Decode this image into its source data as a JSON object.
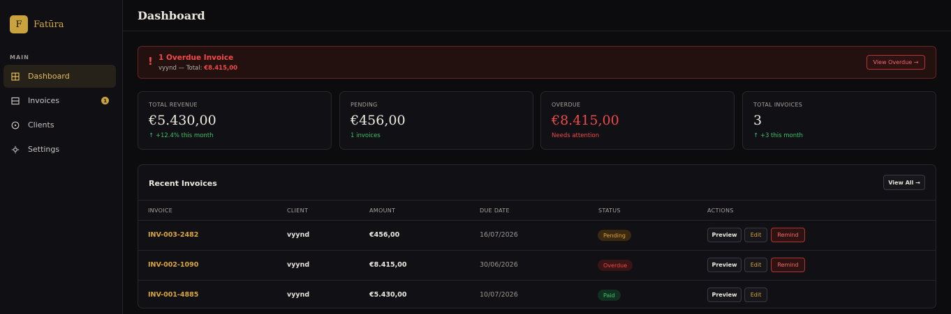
{
  "brand": {
    "logo_letter": "F",
    "name": "Fatūra"
  },
  "sidebar": {
    "section_label": "MAIN",
    "items": [
      {
        "label": "Dashboard",
        "icon": "grid-icon",
        "active": true
      },
      {
        "label": "Invoices",
        "icon": "invoice-icon",
        "badge": "1"
      },
      {
        "label": "Clients",
        "icon": "clients-icon"
      },
      {
        "label": "Settings",
        "icon": "gear-icon"
      }
    ]
  },
  "header": {
    "title": "Dashboard"
  },
  "alert": {
    "mark": "!",
    "title": "1 Overdue Invoice",
    "sub_prefix": "vyynd — Total:",
    "sub_amount": "€8.415,00",
    "button": "View Overdue →"
  },
  "stats": [
    {
      "label": "TOTAL REVENUE",
      "value": "€5.430,00",
      "sub": "↑ +12.4% this month"
    },
    {
      "label": "PENDING",
      "value": "€456,00",
      "sub": "1 invoices"
    },
    {
      "label": "OVERDUE",
      "value": "€8.415,00",
      "sub": "Needs attention"
    },
    {
      "label": "TOTAL INVOICES",
      "value": "3",
      "sub": "↑ +3 this month"
    }
  ],
  "recent": {
    "title": "Recent Invoices",
    "view_all": "View All →",
    "columns": [
      "INVOICE",
      "CLIENT",
      "AMOUNT",
      "DUE DATE",
      "STATUS",
      "ACTIONS"
    ],
    "rows": [
      {
        "invoice": "INV-003-2482",
        "client": "vyynd",
        "amount": "€456,00",
        "due": "16/07/2026",
        "status": "Pending",
        "preview": "Preview",
        "edit": "Edit",
        "remind": "Remind"
      },
      {
        "invoice": "INV-002-1090",
        "client": "vyynd",
        "amount": "€8.415,00",
        "due": "30/06/2026",
        "status": "Overdue",
        "preview": "Preview",
        "edit": "Edit",
        "remind": "Remind"
      },
      {
        "invoice": "INV-001-4885",
        "client": "vyynd",
        "amount": "€5.430,00",
        "due": "10/07/2026",
        "status": "Paid",
        "preview": "Preview",
        "edit": "Edit"
      }
    ]
  },
  "colors": {
    "accent": "#caa23e",
    "danger": "#f04a4a",
    "success": "#38c266",
    "background": "#0c0c0e"
  }
}
